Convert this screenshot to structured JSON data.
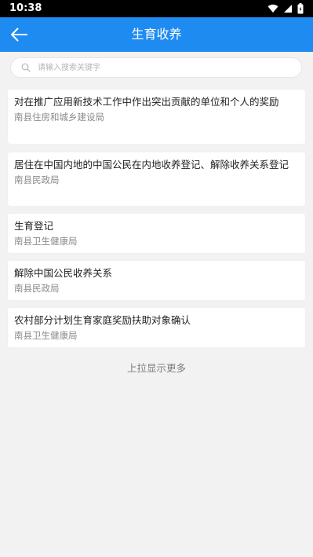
{
  "status_bar": {
    "time": "10:38",
    "icons": [
      "wifi-icon",
      "signal-icon",
      "battery-icon"
    ]
  },
  "header": {
    "title": "生育收养",
    "back_icon": "arrow-left-icon",
    "background_color": "#1e8bf1"
  },
  "search": {
    "placeholder": "请输入搜索关键字",
    "value": "",
    "icon": "search-icon"
  },
  "items": [
    {
      "title": "对在推广应用新技术工作中作出突出贡献的单位和个人的奖励",
      "dept": "南县住房和城乡建设局"
    },
    {
      "title": "居住在中国内地的中国公民在内地收养登记、解除收养关系登记",
      "dept": "南县民政局"
    },
    {
      "title": "生育登记",
      "dept": "南县卫生健康局"
    },
    {
      "title": "解除中国公民收养关系",
      "dept": "南县民政局"
    },
    {
      "title": "农村部分计划生育家庭奖励扶助对象确认",
      "dept": "南县卫生健康局"
    }
  ],
  "footer": {
    "load_more": "上拉显示更多"
  }
}
